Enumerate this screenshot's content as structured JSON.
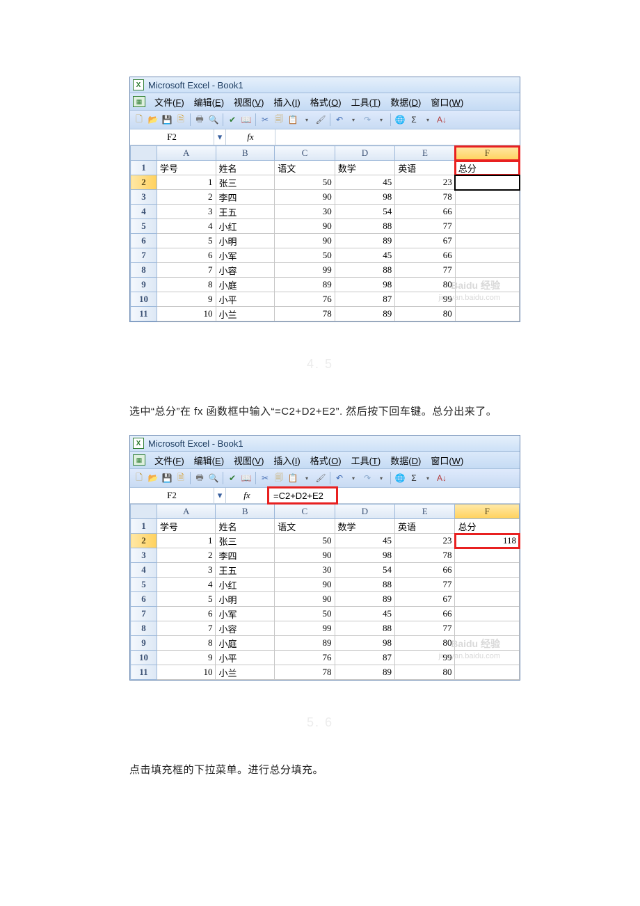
{
  "app_title": "Microsoft Excel - Book1",
  "menu": [
    {
      "label": "文件",
      "key": "F"
    },
    {
      "label": "编辑",
      "key": "E"
    },
    {
      "label": "视图",
      "key": "V"
    },
    {
      "label": "插入",
      "key": "I"
    },
    {
      "label": "格式",
      "key": "O"
    },
    {
      "label": "工具",
      "key": "T"
    },
    {
      "label": "数据",
      "key": "D"
    },
    {
      "label": "窗口",
      "key": "W"
    }
  ],
  "namebox": "F2",
  "fx_label": "fx",
  "formula_value_1": "",
  "formula_value_2": "=C2+D2+E2",
  "columns": [
    "A",
    "B",
    "C",
    "D",
    "E",
    "F"
  ],
  "headers": {
    "A": "学号",
    "B": "姓名",
    "C": "语文",
    "D": "数学",
    "E": "英语",
    "F": "总分"
  },
  "rows": [
    {
      "n": 1,
      "A": "1",
      "B": "张三",
      "C": "50",
      "D": "45",
      "E": "23"
    },
    {
      "n": 2,
      "A": "2",
      "B": "李四",
      "C": "90",
      "D": "98",
      "E": "78"
    },
    {
      "n": 3,
      "A": "3",
      "B": "王五",
      "C": "30",
      "D": "54",
      "E": "66"
    },
    {
      "n": 4,
      "A": "4",
      "B": "小红",
      "C": "90",
      "D": "88",
      "E": "77"
    },
    {
      "n": 5,
      "A": "5",
      "B": "小明",
      "C": "90",
      "D": "89",
      "E": "67"
    },
    {
      "n": 6,
      "A": "6",
      "B": "小军",
      "C": "50",
      "D": "45",
      "E": "66"
    },
    {
      "n": 7,
      "A": "7",
      "B": "小容",
      "C": "99",
      "D": "88",
      "E": "77"
    },
    {
      "n": 8,
      "A": "8",
      "B": "小庭",
      "C": "89",
      "D": "98",
      "E": "80"
    },
    {
      "n": 9,
      "A": "9",
      "B": "小平",
      "C": "76",
      "D": "87",
      "E": "99"
    },
    {
      "n": 10,
      "A": "10",
      "B": "小兰",
      "C": "78",
      "D": "89",
      "E": "80"
    }
  ],
  "result_f2": "118",
  "step1_num": "4. 5",
  "step1_text": "选中“总分”在 fx 函数框中输入“=C2+D2+E2”. 然后按下回车键。总分出来了。",
  "step2_num": "5. 6",
  "step2_text": "点击填充框的下拉菜单。进行总分填充。",
  "watermark": {
    "brand": "Baidu 经验",
    "url": "jingyan.baidu.com"
  },
  "sigma": "Σ"
}
